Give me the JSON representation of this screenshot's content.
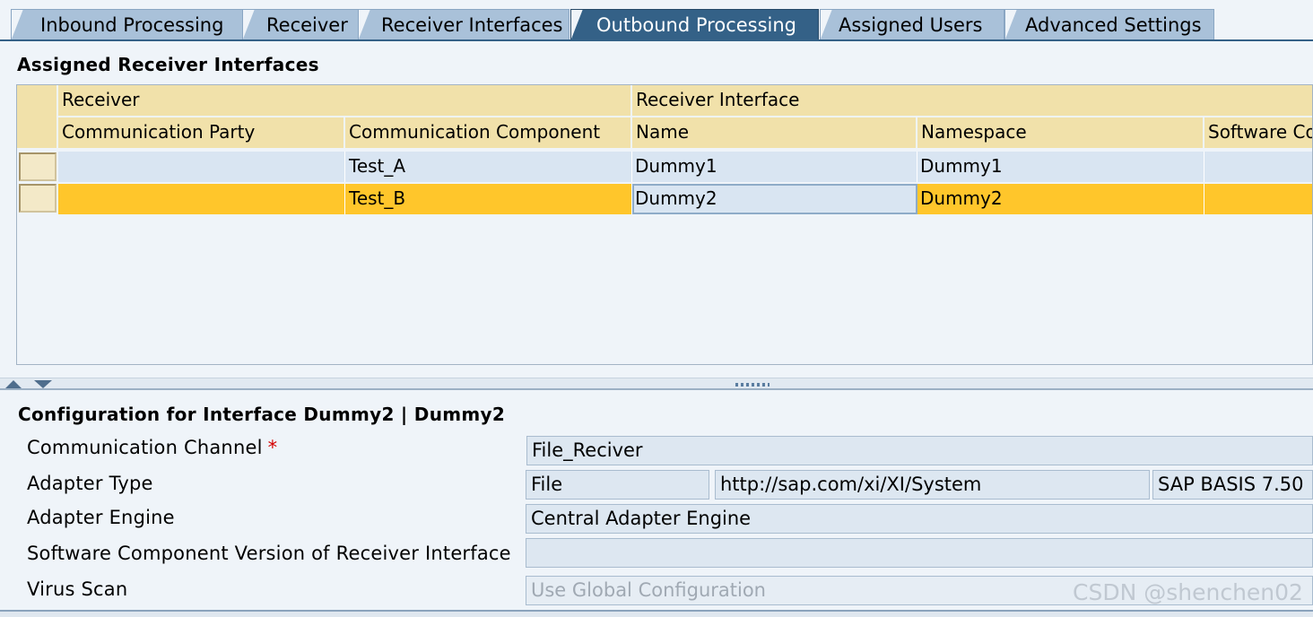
{
  "tabs": [
    {
      "label": "Inbound Processing",
      "active": false
    },
    {
      "label": "Receiver",
      "active": false
    },
    {
      "label": "Receiver Interfaces",
      "active": false
    },
    {
      "label": "Outbound Processing",
      "active": true
    },
    {
      "label": "Assigned Users",
      "active": false
    },
    {
      "label": "Advanced Settings",
      "active": false
    }
  ],
  "table": {
    "title": "Assigned Receiver Interfaces",
    "group_headers": {
      "receiver": "Receiver",
      "receiver_interface": "Receiver Interface"
    },
    "columns": [
      "Communication Party",
      "Communication Component",
      "Name",
      "Namespace",
      "Software Co"
    ],
    "rows": [
      {
        "party": "",
        "component": "Test_A",
        "name": "Dummy1",
        "namespace": "Dummy1",
        "software": "",
        "selected": false
      },
      {
        "party": "",
        "component": "Test_B",
        "name": "Dummy2",
        "namespace": "Dummy2",
        "software": "",
        "selected": true
      }
    ]
  },
  "config": {
    "title": "Configuration for Interface Dummy2 | Dummy2",
    "communication_channel": {
      "label": "Communication Channel",
      "required_mark": "*",
      "value": "File_Reciver"
    },
    "adapter_type": {
      "label": "Adapter Type",
      "value": "File",
      "namespace": "http://sap.com/xi/XI/System",
      "software_component": "SAP BASIS 7.50"
    },
    "adapter_engine": {
      "label": "Adapter Engine",
      "value": "Central Adapter Engine"
    },
    "software_component_version": {
      "label": "Software Component Version of Receiver Interface",
      "value": ""
    },
    "virus_scan": {
      "label": "Virus Scan",
      "value": "Use Global Configuration"
    }
  },
  "watermark": "CSDN @shenchen02",
  "colors": {
    "active_tab": "#346187",
    "inactive_tab": "#a9c1d9",
    "table_header": "#f1e1aa",
    "selected_row": "#ffc62b",
    "row_background": "#d9e5f2",
    "required_mark": "#d40000"
  }
}
